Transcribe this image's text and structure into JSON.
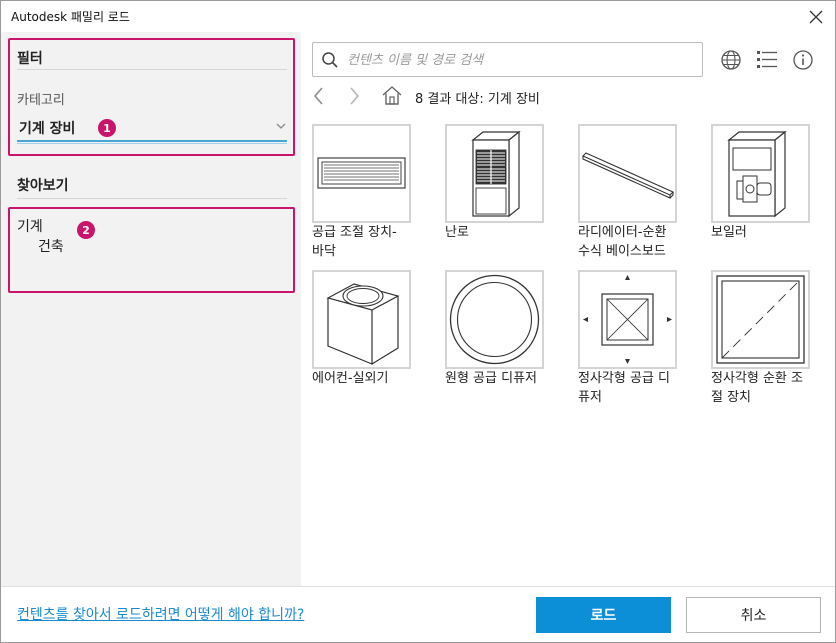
{
  "window": {
    "title": "Autodesk 패밀리 로드"
  },
  "left_panel": {
    "filter_title": "필터",
    "category_label": "카테고리",
    "category_value": "기계 장비",
    "browse_title": "찾아보기",
    "tree": [
      {
        "label": "기계"
      },
      {
        "label": "건축"
      }
    ],
    "badges": [
      "1",
      "2"
    ]
  },
  "search": {
    "placeholder": "컨텐츠 이름 및 경로 검색",
    "value": ""
  },
  "toolbar": {
    "icons": [
      "globe-icon",
      "list-view-icon",
      "info-icon"
    ]
  },
  "nav": {
    "result_text": "8 결과 대상: 기계 장비"
  },
  "items": [
    {
      "label": "공급 조절 장치-\n바닥",
      "icon": "floor-register-thumbnail"
    },
    {
      "label": "난로",
      "icon": "furnace-thumbnail"
    },
    {
      "label": "라디에이터-순환\n수식 베이스보드",
      "icon": "baseboard-radiator-thumbnail"
    },
    {
      "label": "보일러",
      "icon": "boiler-thumbnail"
    },
    {
      "label": "에어컨-실외기",
      "icon": "outdoor-ac-thumbnail"
    },
    {
      "label": "원형 공급 디퓨저",
      "icon": "round-diffuser-thumbnail"
    },
    {
      "label": "정사각형 공급 디\n퓨저",
      "icon": "square-diffuser-thumbnail"
    },
    {
      "label": "정사각형 순환 조\n절 장치",
      "icon": "square-return-register-thumbnail"
    }
  ],
  "footer": {
    "help_link": "컨텐츠를 찾아서 로드하려면 어떻게 해야 합니까?",
    "load_button": "로드",
    "cancel_button": "취소"
  },
  "colors": {
    "highlight": "#c8146a",
    "primary": "#0c8fd6",
    "link": "#1a8ad1",
    "panel_bg": "#f2f2f2"
  }
}
